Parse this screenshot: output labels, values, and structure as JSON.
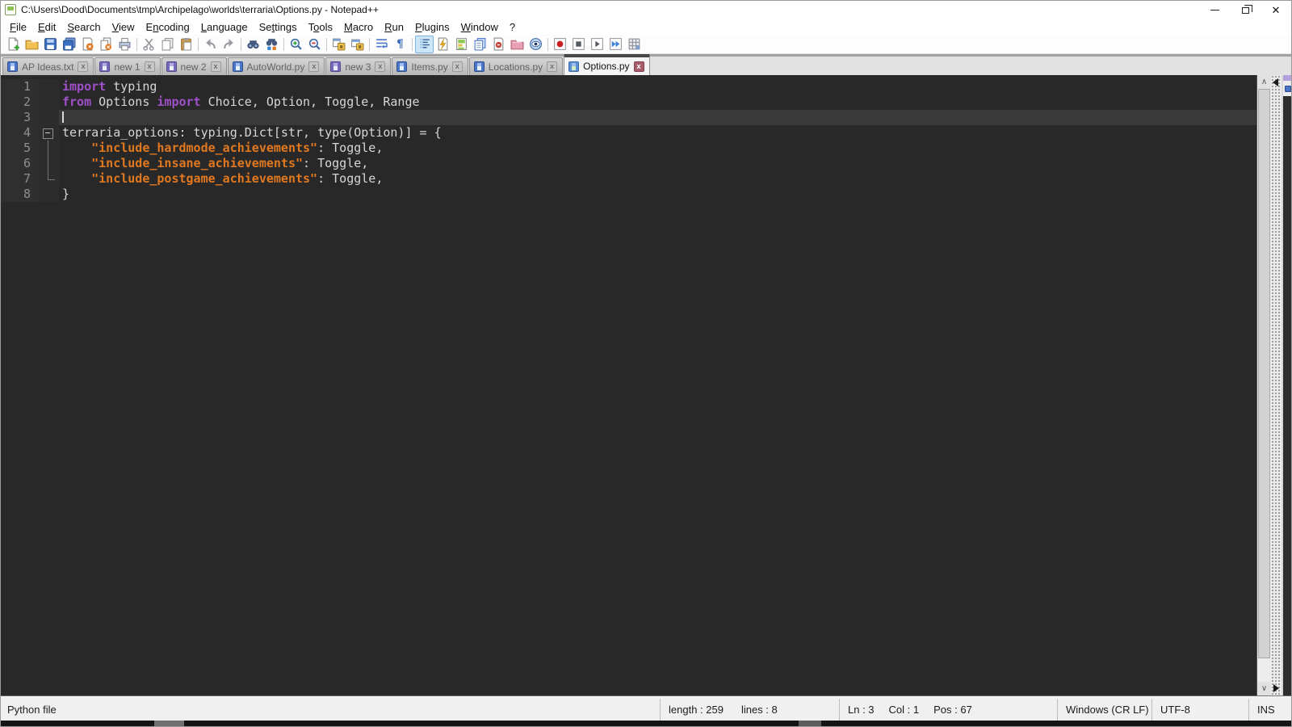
{
  "window": {
    "title": "C:\\Users\\Dood\\Documents\\tmp\\Archipelago\\worlds\\terraria\\Options.py - Notepad++"
  },
  "menu": {
    "items": [
      {
        "label": "File"
      },
      {
        "label": "Edit"
      },
      {
        "label": "Search"
      },
      {
        "label": "View"
      },
      {
        "label": "Encoding"
      },
      {
        "label": "Language"
      },
      {
        "label": "Settings"
      },
      {
        "label": "Tools"
      },
      {
        "label": "Macro"
      },
      {
        "label": "Run"
      },
      {
        "label": "Plugins"
      },
      {
        "label": "Window"
      },
      {
        "label": "?"
      }
    ]
  },
  "toolbar": {
    "icons": [
      "new-file",
      "open-file",
      "save-file",
      "save-all",
      "close-file",
      "close-all",
      "print",
      "cut",
      "copy",
      "paste",
      "undo",
      "redo",
      "find",
      "replace",
      "zoom-in",
      "zoom-out",
      "sync-vertical-scroll",
      "sync-horizontal-scroll",
      "word-wrap",
      "show-all-characters",
      "show-indent-guide",
      "function-list",
      "document-map",
      "document-list",
      "plugin",
      "folder-as-workspace",
      "monitoring",
      "record-macro",
      "stop-macro",
      "play-macro",
      "run-macro-multiple",
      "save-recorded-macro"
    ],
    "pilcrow": "¶"
  },
  "tabbar": {
    "tabs": [
      {
        "label": "AP Ideas.txt",
        "state": "saved",
        "active": false,
        "close": "x"
      },
      {
        "label": "new 1",
        "state": "new",
        "active": false,
        "close": "x"
      },
      {
        "label": "new 2",
        "state": "new",
        "active": false,
        "close": "x"
      },
      {
        "label": "AutoWorld.py",
        "state": "saved",
        "active": false,
        "close": "x"
      },
      {
        "label": "new 3",
        "state": "new",
        "active": false,
        "close": "x"
      },
      {
        "label": "Items.py",
        "state": "saved",
        "active": false,
        "close": "x"
      },
      {
        "label": "Locations.py",
        "state": "saved",
        "active": false,
        "close": "x"
      },
      {
        "label": "Options.py",
        "state": "saved",
        "active": true,
        "close": "x"
      }
    ]
  },
  "editor": {
    "caret_line": 3,
    "lines": [
      {
        "num": "1",
        "tokens": [
          {
            "type": "keyword",
            "text": "import"
          },
          {
            "type": "default",
            "text": " typing"
          }
        ]
      },
      {
        "num": "2",
        "tokens": [
          {
            "type": "keyword",
            "text": "from"
          },
          {
            "type": "default",
            "text": " Options "
          },
          {
            "type": "keyword",
            "text": "import"
          },
          {
            "type": "default",
            "text": " Choice, Option, Toggle, Range"
          }
        ]
      },
      {
        "num": "3",
        "tokens": []
      },
      {
        "num": "4",
        "tokens": [
          {
            "type": "default",
            "text": "terraria_options: typing.Dict[str, type(Option)] = {"
          }
        ]
      },
      {
        "num": "5",
        "tokens": [
          {
            "type": "default",
            "text": "    "
          },
          {
            "type": "string",
            "text": "\"include_hardmode_achievements\""
          },
          {
            "type": "default",
            "text": ": Toggle,"
          }
        ]
      },
      {
        "num": "6",
        "tokens": [
          {
            "type": "default",
            "text": "    "
          },
          {
            "type": "string",
            "text": "\"include_insane_achievements\""
          },
          {
            "type": "default",
            "text": ": Toggle,"
          }
        ]
      },
      {
        "num": "7",
        "tokens": [
          {
            "type": "default",
            "text": "    "
          },
          {
            "type": "string",
            "text": "\"include_postgame_achievements\""
          },
          {
            "type": "default",
            "text": ": Toggle,"
          }
        ]
      },
      {
        "num": "8",
        "tokens": [
          {
            "type": "default",
            "text": "}"
          }
        ]
      }
    ],
    "colors": {
      "background": "#282828",
      "default_text": "#d6d6d6",
      "keyword": "#a050c8",
      "string": "#e07820",
      "line_number": "#909090",
      "current_line": "#3a3a3a"
    }
  },
  "statusbar": {
    "doc_type": "Python file",
    "length": "length : 259",
    "lines": "lines : 8",
    "line": "Ln : 3",
    "col": "Col : 1",
    "pos": "Pos : 67",
    "eol": "Windows (CR LF)",
    "encoding": "UTF-8",
    "insert_mode": "INS"
  }
}
